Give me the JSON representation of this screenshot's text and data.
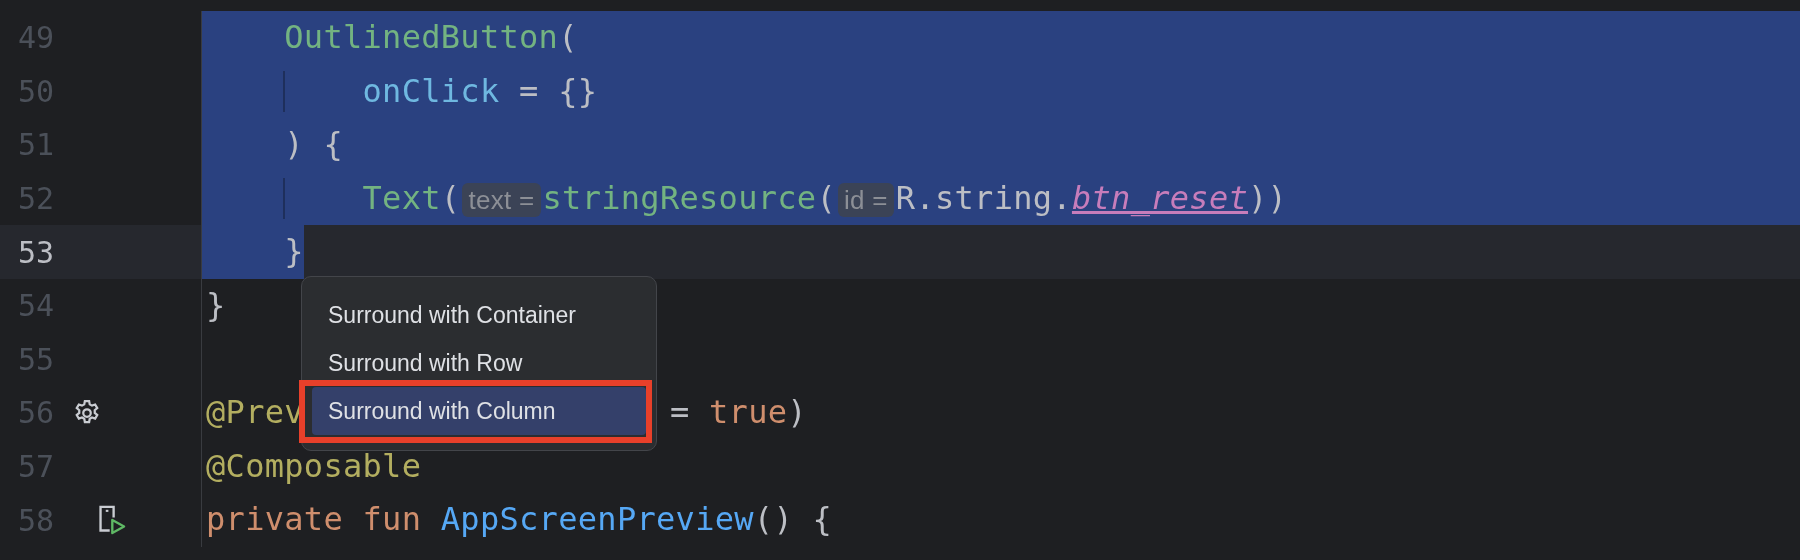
{
  "editor": {
    "lines": [
      {
        "number": "49",
        "selected": true,
        "current": false,
        "guide": false,
        "tokens": [
          {
            "kind": "call",
            "text": "    OutlinedButton"
          },
          {
            "kind": "plain",
            "text": "("
          }
        ]
      },
      {
        "number": "50",
        "selected": true,
        "current": false,
        "guide": true,
        "tokens": [
          {
            "kind": "param",
            "text": "        onClick"
          },
          {
            "kind": "plain",
            "text": " = {}"
          }
        ]
      },
      {
        "number": "51",
        "selected": true,
        "current": false,
        "guide": false,
        "tokens": [
          {
            "kind": "plain",
            "text": "    ) {"
          }
        ]
      },
      {
        "number": "52",
        "selected": true,
        "current": false,
        "guide": true,
        "tokens": [
          {
            "kind": "call",
            "text": "        Text"
          },
          {
            "kind": "plain",
            "text": "("
          },
          {
            "kind": "hint",
            "text": "text ="
          },
          {
            "kind": "call",
            "text": "stringResource"
          },
          {
            "kind": "plain",
            "text": "("
          },
          {
            "kind": "hint",
            "text": "id ="
          },
          {
            "kind": "plain",
            "text": "R.string."
          },
          {
            "kind": "resource",
            "text": "btn_reset"
          },
          {
            "kind": "plain",
            "text": "))"
          }
        ]
      },
      {
        "number": "53",
        "selected": true,
        "current": true,
        "guide": false,
        "tokens": [
          {
            "kind": "plain",
            "text": "    }"
          }
        ]
      },
      {
        "number": "54",
        "selected": false,
        "current": false,
        "guide": false,
        "tokens": [
          {
            "kind": "plain",
            "text": "}"
          }
        ]
      },
      {
        "number": "55",
        "selected": false,
        "current": false,
        "guide": false
      },
      {
        "number": "56",
        "selected": false,
        "current": false,
        "guide": false,
        "gutter_icon": {
          "kind": "gear"
        },
        "tokens": [
          {
            "kind": "annotation",
            "text": "@Prev"
          },
          {
            "kind": "covered"
          },
          {
            "kind": "plain",
            "text": "= "
          },
          {
            "kind": "keyword",
            "text": "true"
          },
          {
            "kind": "plain",
            "text": ")"
          }
        ]
      },
      {
        "number": "57",
        "selected": false,
        "current": false,
        "guide": false,
        "tokens": [
          {
            "kind": "annotation",
            "text": "@Composable"
          }
        ]
      },
      {
        "number": "58",
        "selected": false,
        "current": false,
        "guide": false,
        "gutter_icon": {
          "kind": "run-device"
        },
        "tokens": [
          {
            "kind": "keyword",
            "text": "private fun "
          },
          {
            "kind": "declaration",
            "text": "AppScreenPreview"
          },
          {
            "kind": "plain",
            "text": "() {"
          }
        ]
      }
    ]
  },
  "popup_menu": {
    "items": [
      {
        "label": "Surround with Container",
        "selected": false,
        "highlighted": false
      },
      {
        "label": "Surround with Row",
        "selected": false,
        "highlighted": false
      },
      {
        "label": "Surround with Column",
        "selected": true,
        "highlighted": true
      }
    ]
  }
}
